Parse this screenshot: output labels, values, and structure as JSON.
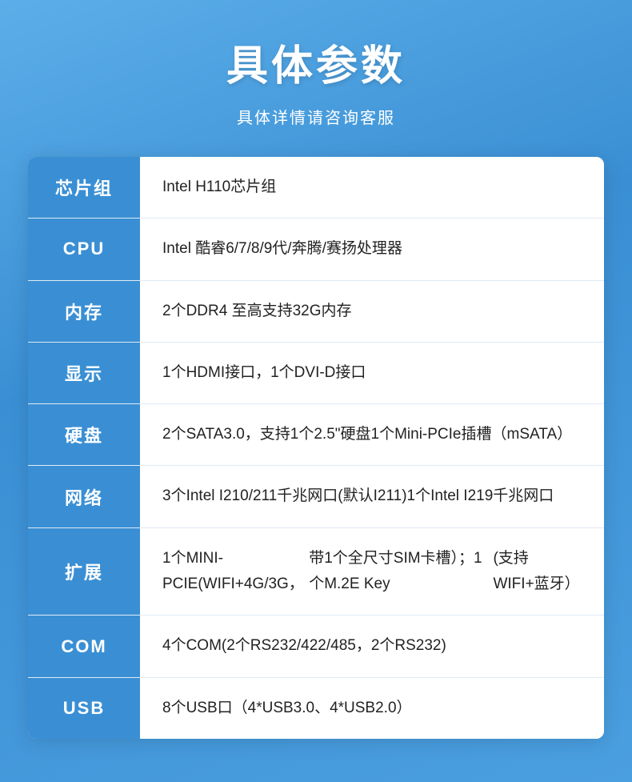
{
  "header": {
    "title": "具体参数",
    "subtitle": "具体详情请咨询客服"
  },
  "table": {
    "rows": [
      {
        "id": "chipset",
        "label": "芯片组",
        "value": "Intel H110芯片组"
      },
      {
        "id": "cpu",
        "label": "CPU",
        "value": "Intel 酷睿6/7/8/9代/奔腾/赛扬处理器"
      },
      {
        "id": "memory",
        "label": "内存",
        "value": "2个DDR4 至高支持32G内存"
      },
      {
        "id": "display",
        "label": "显示",
        "value": "1个HDMI接口，1个DVI-D接口"
      },
      {
        "id": "storage",
        "label": "硬盘",
        "value": "2个SATA3.0，支持1个2.5\"硬盘\n1个Mini-PCIe插槽（mSATA）"
      },
      {
        "id": "network",
        "label": "网络",
        "value": "3个Intel I210/211千兆网口(默认I211)\n1个Intel I219千兆网口"
      },
      {
        "id": "expansion",
        "label": "扩展",
        "value": "1个MINI-PCIE(WIFI+4G/3G，\n带1个全尺寸SIM卡槽）；1个M.2E Key\n(支持WIFI+蓝牙）"
      },
      {
        "id": "com",
        "label": "COM",
        "value": "4个COM(2个RS232/422/485，2个RS232)"
      },
      {
        "id": "usb",
        "label": "USB",
        "value": "8个USB口（4*USB3.0、4*USB2.0）"
      }
    ]
  }
}
